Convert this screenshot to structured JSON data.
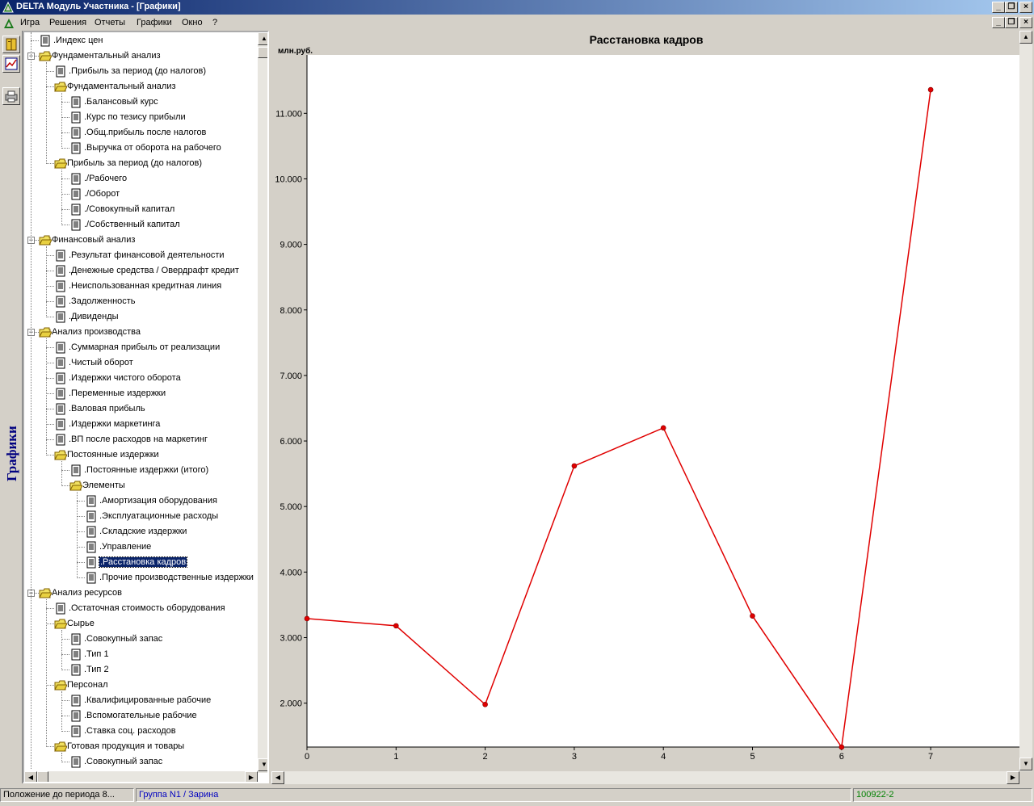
{
  "window": {
    "title": "DELTA Модуль Участника - [Графики]"
  },
  "menu": {
    "items": [
      "Игра",
      "Решения",
      "Отчеты",
      "Графики",
      "Окно",
      "?"
    ]
  },
  "sidebar": {
    "vertical_label": "Графики"
  },
  "tree": {
    "nodes": [
      {
        "label": ".Индекс цен",
        "type": "doc",
        "level": 1
      },
      {
        "label": "Фундаментальный анализ",
        "type": "folder",
        "level": 1
      },
      {
        "label": ".Прибыль за период (до налогов)",
        "type": "doc",
        "level": 2
      },
      {
        "label": "Фундаментальный анализ",
        "type": "folder",
        "level": 2
      },
      {
        "label": ".Балансовый курс",
        "type": "doc",
        "level": 3
      },
      {
        "label": ".Курс по тезису прибыли",
        "type": "doc",
        "level": 3
      },
      {
        "label": ".Общ.прибыль после налогов",
        "type": "doc",
        "level": 3
      },
      {
        "label": ".Выручка от оборота на рабочего",
        "type": "doc",
        "level": 3
      },
      {
        "label": "Прибыль за период (до налогов)",
        "type": "folder",
        "level": 2
      },
      {
        "label": "./Рабочего",
        "type": "doc",
        "level": 3
      },
      {
        "label": "./Оборот",
        "type": "doc",
        "level": 3
      },
      {
        "label": "./Совокупный капитал",
        "type": "doc",
        "level": 3
      },
      {
        "label": "./Собственный капитал",
        "type": "doc",
        "level": 3
      },
      {
        "label": "Финансовый анализ",
        "type": "folder",
        "level": 1
      },
      {
        "label": ".Результат финансовой деятельности",
        "type": "doc",
        "level": 2
      },
      {
        "label": ".Денежные средства / Овердрафт кредит",
        "type": "doc",
        "level": 2
      },
      {
        "label": ".Неиспользованная кредитная линия",
        "type": "doc",
        "level": 2
      },
      {
        "label": ".Задолженность",
        "type": "doc",
        "level": 2
      },
      {
        "label": ".Дивиденды",
        "type": "doc",
        "level": 2
      },
      {
        "label": "Анализ производства",
        "type": "folder",
        "level": 1
      },
      {
        "label": ".Суммарная прибыль от реализации",
        "type": "doc",
        "level": 2
      },
      {
        "label": ".Чистый оборот",
        "type": "doc",
        "level": 2
      },
      {
        "label": ".Издержки чистого оборота",
        "type": "doc",
        "level": 2
      },
      {
        "label": ".Переменные издержки",
        "type": "doc",
        "level": 2
      },
      {
        "label": ".Валовая прибыль",
        "type": "doc",
        "level": 2
      },
      {
        "label": ".Издержки маркетинга",
        "type": "doc",
        "level": 2
      },
      {
        "label": ".ВП после расходов на маркетинг",
        "type": "doc",
        "level": 2
      },
      {
        "label": "Постоянные издержки",
        "type": "folder",
        "level": 2
      },
      {
        "label": ".Постоянные издержки (итого)",
        "type": "doc",
        "level": 3
      },
      {
        "label": "Элементы",
        "type": "folder",
        "level": 3
      },
      {
        "label": ".Амортизация оборудования",
        "type": "doc",
        "level": 4
      },
      {
        "label": ".Эксплуатационные расходы",
        "type": "doc",
        "level": 4
      },
      {
        "label": ".Складские издержки",
        "type": "doc",
        "level": 4
      },
      {
        "label": ".Управление",
        "type": "doc",
        "level": 4
      },
      {
        "label": ".Расстановка кадров",
        "type": "doc",
        "level": 4,
        "selected": true
      },
      {
        "label": ".Прочие производственные издержки",
        "type": "doc",
        "level": 4
      },
      {
        "label": "Анализ ресурсов",
        "type": "folder",
        "level": 1
      },
      {
        "label": ".Остаточная стоимость оборудования",
        "type": "doc",
        "level": 2
      },
      {
        "label": "Сырье",
        "type": "folder",
        "level": 2
      },
      {
        "label": ".Совокупный запас",
        "type": "doc",
        "level": 3
      },
      {
        "label": ".Тип 1",
        "type": "doc",
        "level": 3
      },
      {
        "label": ".Тип 2",
        "type": "doc",
        "level": 3
      },
      {
        "label": "Персонал",
        "type": "folder",
        "level": 2
      },
      {
        "label": ".Квалифицированные рабочие",
        "type": "doc",
        "level": 3
      },
      {
        "label": ".Вспомогательные рабочие",
        "type": "doc",
        "level": 3
      },
      {
        "label": ".Ставка соц. расходов",
        "type": "doc",
        "level": 3
      },
      {
        "label": "Готовая продукция и товары",
        "type": "folder",
        "level": 2
      },
      {
        "label": ".Совокупный запас",
        "type": "doc",
        "level": 3
      }
    ]
  },
  "chart_data": {
    "type": "line",
    "title": "Расстановка кадров",
    "ylabel": "млн.руб.",
    "xlabel": "",
    "x": [
      0,
      1,
      2,
      3,
      4,
      5,
      6,
      7
    ],
    "x_ticks": [
      "0",
      "1",
      "2",
      "3",
      "4",
      "5",
      "6",
      "7"
    ],
    "y_ticks": [
      "2.000",
      "3.000",
      "4.000",
      "5.000",
      "6.000",
      "7.000",
      "8.000",
      "9.000",
      "10.000",
      "11.000"
    ],
    "xlim": [
      0,
      8
    ],
    "ylim": [
      1.33,
      11.62
    ],
    "series": [
      {
        "values": [
          3.29,
          3.18,
          1.98,
          5.62,
          6.2,
          3.33,
          1.33,
          11.36
        ],
        "color": "#e00000"
      }
    ],
    "grid": false
  },
  "status": {
    "left": "Положение до периода 8...",
    "group": "Группа N1 / Зарина",
    "code": "100922-2"
  },
  "colors": {
    "titlebar_start": "#0a246a",
    "titlebar_end": "#a6caf0",
    "series_line": "#e00000",
    "group_text": "#0000c0",
    "code_text": "#008000",
    "vertical_label": "#000080"
  }
}
